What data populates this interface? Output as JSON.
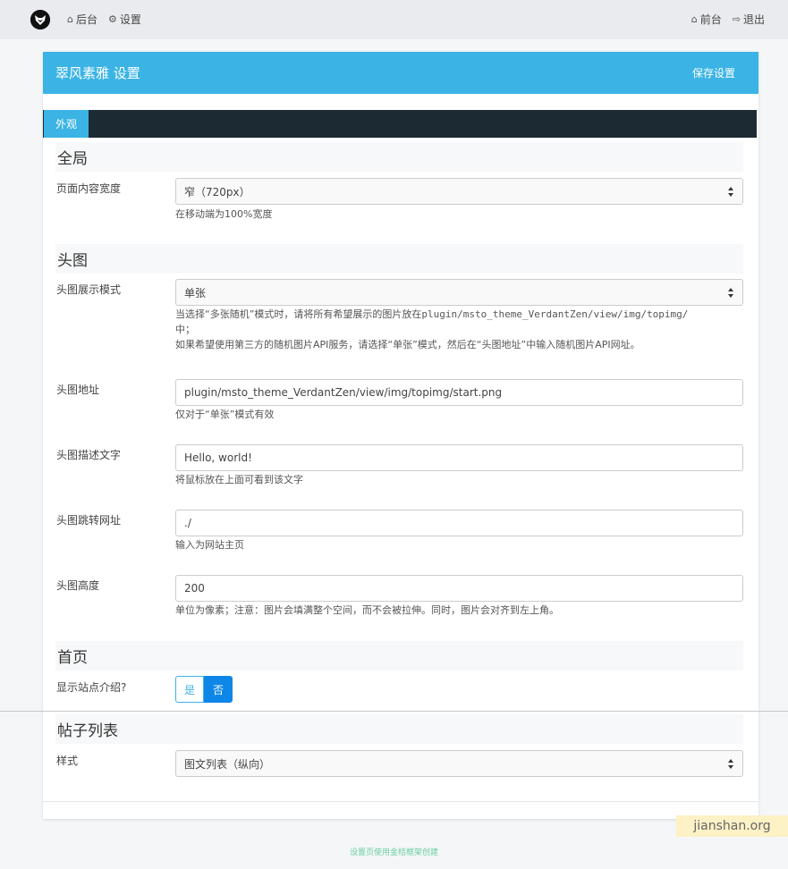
{
  "nav": {
    "left": [
      {
        "icon": "home-icon",
        "label": "后台"
      },
      {
        "icon": "gear-icon",
        "label": "设置"
      }
    ],
    "right": [
      {
        "icon": "home-icon",
        "label": "前台"
      },
      {
        "icon": "logout-icon",
        "label": "退出"
      }
    ]
  },
  "panel": {
    "title": "翠风素雅 设置",
    "save_label": "保存设置",
    "accent": "#3bb4e5",
    "tab_label": "外观"
  },
  "sections": {
    "global": {
      "title": "全局",
      "width_label": "页面内容宽度",
      "width_value": "窄（720px）",
      "width_help": "在移动端为100%宽度"
    },
    "header": {
      "title": "头图",
      "mode_label": "头图展示模式",
      "mode_value": "单张",
      "mode_help_1a": "当选择“多张随机”模式时，请将所有希望展示的图片放在",
      "mode_help_1b": "plugin/msto_theme_VerdantZen/view/img/topimg/",
      "mode_help_1c": "中；",
      "mode_help_2": "如果希望使用第三方的随机图片API服务，请选择“单张”模式，然后在“头图地址”中输入随机图片API网址。",
      "url_label": "头图地址",
      "url_value": "plugin/msto_theme_VerdantZen/view/img/topimg/start.png",
      "url_help": "仅对于“单张”模式有效",
      "desc_label": "头图描述文字",
      "desc_value": "Hello, world!",
      "desc_help": "将鼠标放在上面可看到该文字",
      "link_label": "头图跳转网址",
      "link_value": "./",
      "link_help": "输入为网站主页",
      "height_label": "头图高度",
      "height_value": "200",
      "height_help": "单位为像素；注意：图片会填满整个空间，而不会被拉伸。同时，图片会对齐到左上角。"
    },
    "home": {
      "title": "首页",
      "intro_label": "显示站点介绍?",
      "yes": "是",
      "no": "否",
      "selected": "否"
    },
    "postlist": {
      "title": "帖子列表",
      "style_label": "样式",
      "style_value": "图文列表（纵向）"
    }
  },
  "watermark": "jianshan.org",
  "footer": "设置页使用金桔框架创建"
}
